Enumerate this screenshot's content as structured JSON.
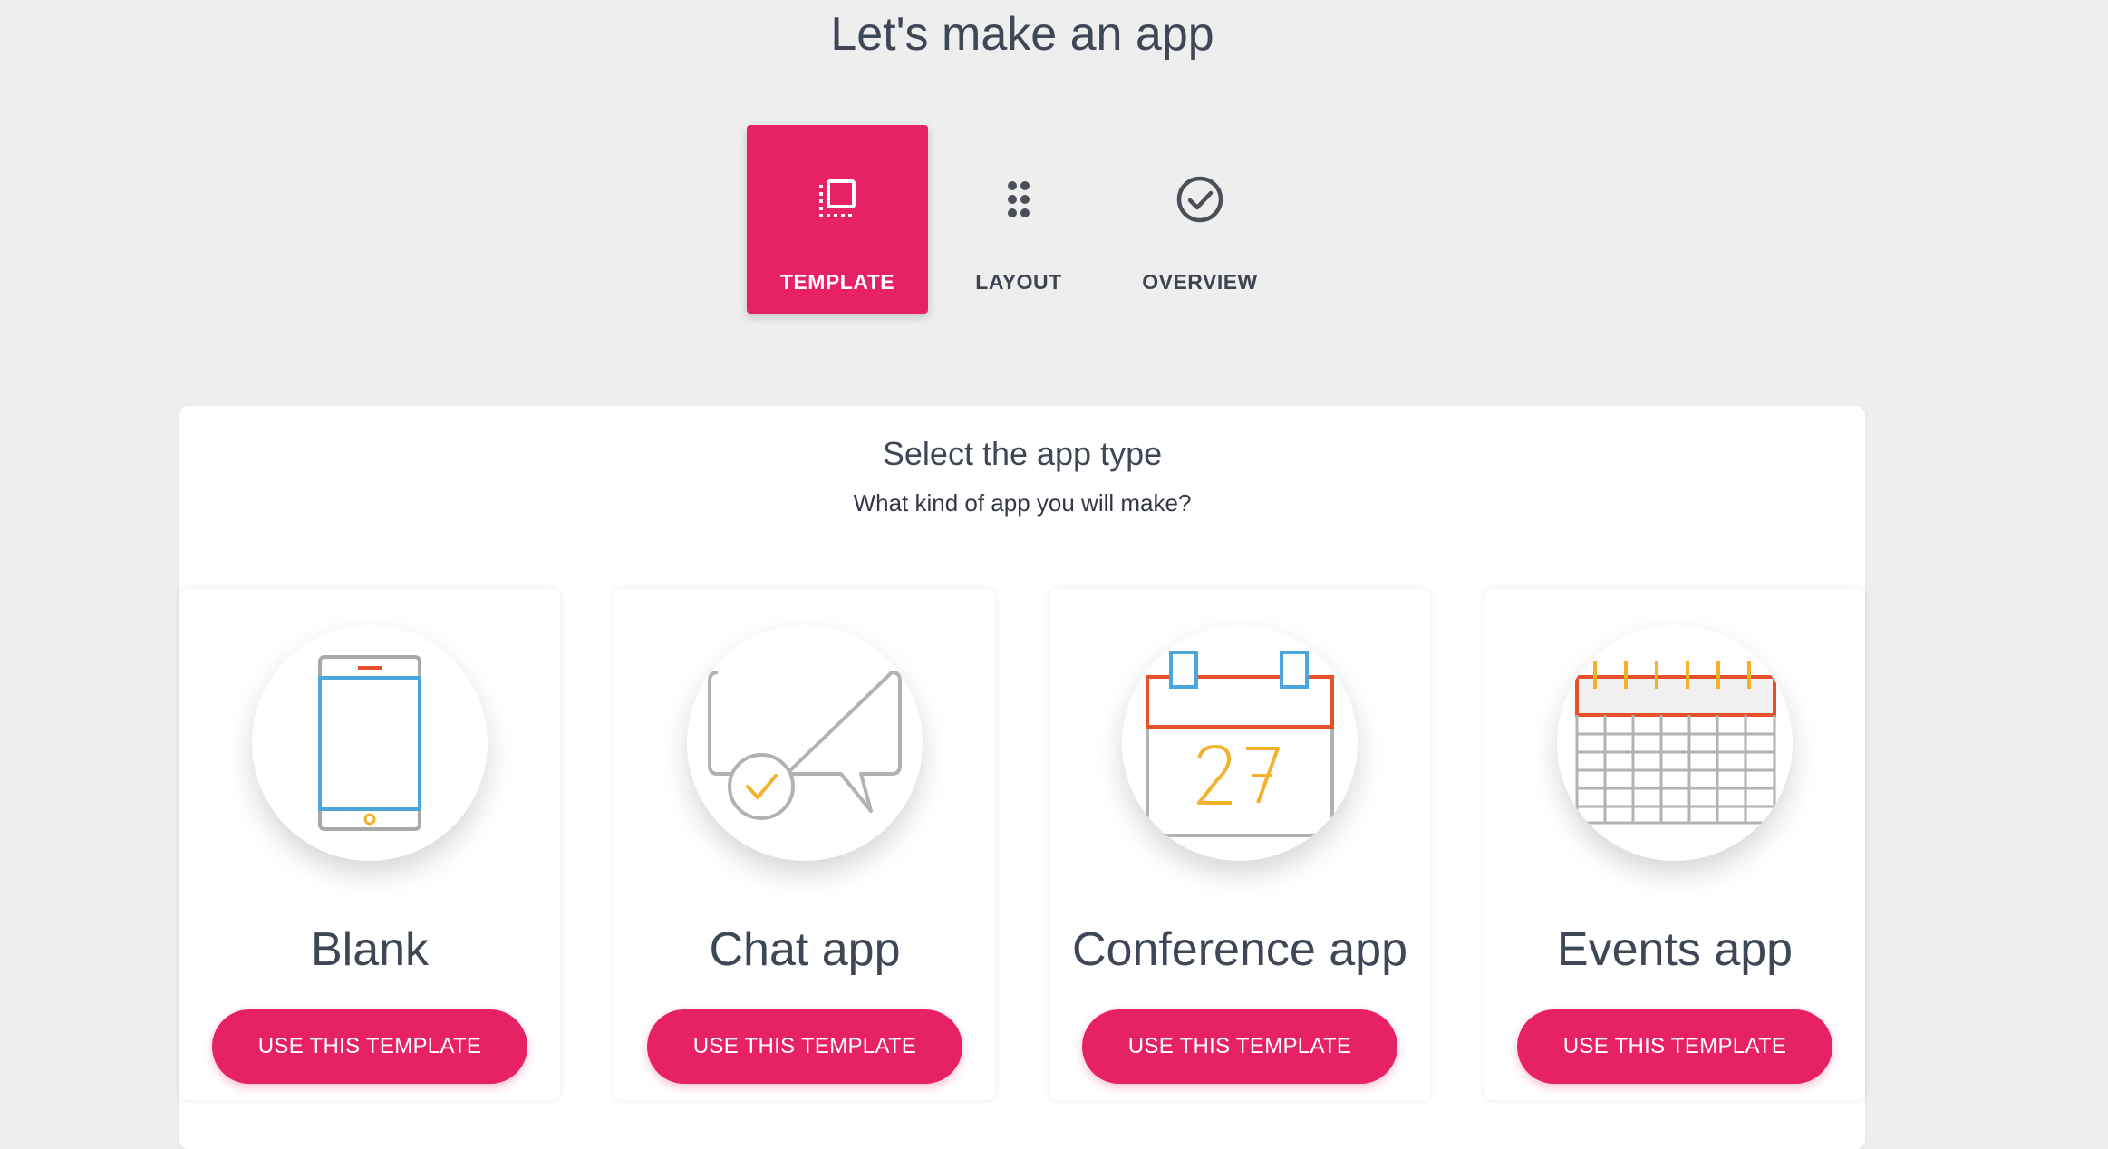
{
  "page": {
    "title": "Let's make an app"
  },
  "steps": [
    {
      "label": "TEMPLATE",
      "icon": "template-icon",
      "active": true
    },
    {
      "label": "LAYOUT",
      "icon": "grid-dots-icon",
      "active": false
    },
    {
      "label": "OVERVIEW",
      "icon": "check-circle-icon",
      "active": false
    }
  ],
  "panel": {
    "title": "Select the app type",
    "subtitle": "What kind of app you will make?"
  },
  "templates": [
    {
      "name": "Blank",
      "button": "USE THIS TEMPLATE",
      "icon": "phone-icon"
    },
    {
      "name": "Chat app",
      "button": "USE THIS TEMPLATE",
      "icon": "chat-bubble-icon"
    },
    {
      "name": "Conference app",
      "button": "USE THIS TEMPLATE",
      "icon": "calendar-27-icon"
    },
    {
      "name": "Events app",
      "button": "USE THIS TEMPLATE",
      "icon": "calendar-grid-icon"
    }
  ],
  "colors": {
    "accent": "#e62264",
    "background": "#eeeeee",
    "text": "#3f4656"
  }
}
